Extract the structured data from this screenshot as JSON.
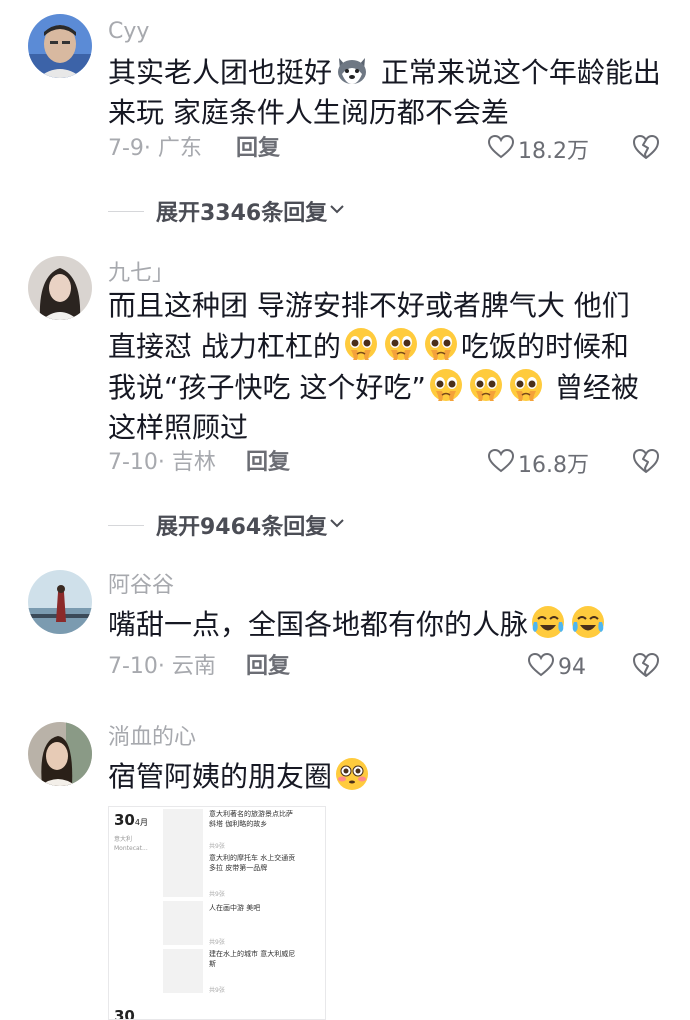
{
  "comments": [
    {
      "username": "Cyy",
      "text_parts": [
        "其实老人团也挺好",
        "emoji:husky",
        " 正常来说这个年龄能出来玩 家庭条件人生阅历都不会差"
      ],
      "date_region": "7-9· 广东",
      "reply_label": "回复",
      "likes": "18.2万",
      "expand_label": "展开3346条回复"
    },
    {
      "username": "九七」",
      "text_parts": [
        "而且这种团 导游安排不好或者脾气大 他们直接怼 战力杠杠的",
        "emoji:pleading",
        "emoji:pleading",
        "emoji:pleading",
        "吃饭的时候和我说“孩子快吃 这个好吃”",
        "emoji:pleading",
        "emoji:pleading",
        "emoji:pleading",
        " 曾经被这样照顾过"
      ],
      "date_region": "7-10· 吉林",
      "reply_label": "回复",
      "likes": "16.8万",
      "expand_label": "展开9464条回复"
    },
    {
      "username": "阿谷谷",
      "text_parts": [
        "嘴甜一点，全国各地都有你的人脉",
        "emoji:teary-laugh",
        "emoji:teary-laugh"
      ],
      "date_region": "7-10· 云南",
      "reply_label": "回复",
      "likes": "94"
    },
    {
      "username": "淌血的心",
      "text_parts": [
        "宿管阿姨的朋友圈",
        "emoji:flushed"
      ]
    }
  ],
  "screenshot": {
    "date_day": "30",
    "date_month": "4月",
    "place": [
      "意大利",
      "Montecat..."
    ],
    "posts": [
      {
        "text": [
          "意大利著名的旅游景点比萨",
          "斜塔 伽利略的故乡"
        ]
      },
      {
        "count": "共9张",
        "text": [
          "意大利的摩托车 水上交通贡",
          "多拉 皮带第一品牌"
        ]
      },
      {
        "count": "共9张",
        "text": [
          "人在画中游 美吧"
        ]
      },
      {
        "count": "共9张",
        "text": [
          "建在水上的城市 意大利威尼",
          "斯"
        ]
      },
      {
        "count": "共9张"
      }
    ],
    "date_day_2": "30"
  },
  "colors": {
    "primary_text": "#161823",
    "secondary_text": "#a7a9ae",
    "action_text": "#6b6d74"
  }
}
